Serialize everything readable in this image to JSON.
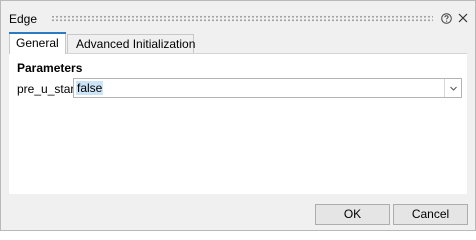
{
  "dialog": {
    "title": "Edge"
  },
  "tabs": [
    {
      "label": "General",
      "active": true
    },
    {
      "label": "Advanced Initialization",
      "active": false
    }
  ],
  "parameters": {
    "section_title": "Parameters",
    "fields": [
      {
        "label": "pre_u_start",
        "value": "false"
      }
    ]
  },
  "buttons": {
    "ok_label": "OK",
    "cancel_label": "Cancel"
  },
  "icons": {
    "help": "help-icon",
    "close": "close-icon",
    "dropdown": "chevron-down-icon"
  },
  "colors": {
    "accent": "#2a7ac4",
    "selection": "#cce4f7",
    "window_bg": "#f0f0f0",
    "panel_bg": "#ffffff"
  }
}
